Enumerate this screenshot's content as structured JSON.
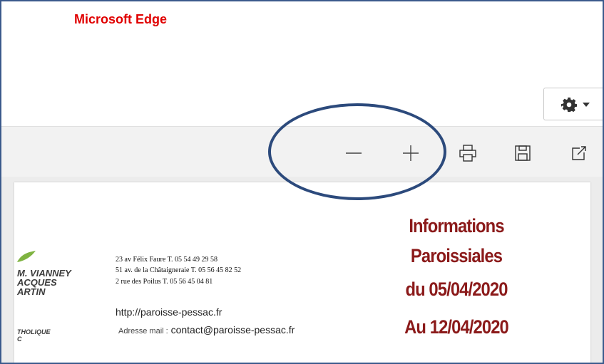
{
  "app": {
    "title": "Microsoft Edge"
  },
  "settings": {
    "icon": "gear-icon",
    "caret": "chevron-down-icon"
  },
  "toolbar": {
    "buttons": [
      {
        "name": "zoom-out",
        "icon": "minus-icon"
      },
      {
        "name": "zoom-in",
        "icon": "plus-icon"
      },
      {
        "name": "print",
        "icon": "printer-icon"
      },
      {
        "name": "save",
        "icon": "save-icon"
      },
      {
        "name": "open-external",
        "icon": "external-link-icon"
      }
    ]
  },
  "document": {
    "logo_lines": [
      "M. VIANNEY",
      "ACQUES",
      "ARTIN",
      "THOLIQUE",
      "C"
    ],
    "addresses": [
      "23 av Félix Faure     T. 05 54 49 29 58",
      "51 av. de la Châtaigneraie  T.  05 56 45 82 52",
      "2 rue des Poilus  T. 05 56 45 04 81"
    ],
    "url": "http://paroisse-pessac.fr",
    "mail_label": "Adresse  mail :",
    "mail": "contact@paroisse-pessac.fr",
    "title_lines": [
      "Informations",
      "Paroissiales",
      "du 05/04/2020",
      "Au 12/04/2020"
    ]
  },
  "colors": {
    "app_title": "#e00000",
    "frame_border": "#3b5a8c",
    "title_text": "#8b1a1a",
    "annotation_ellipse": "#2c4a7c"
  }
}
